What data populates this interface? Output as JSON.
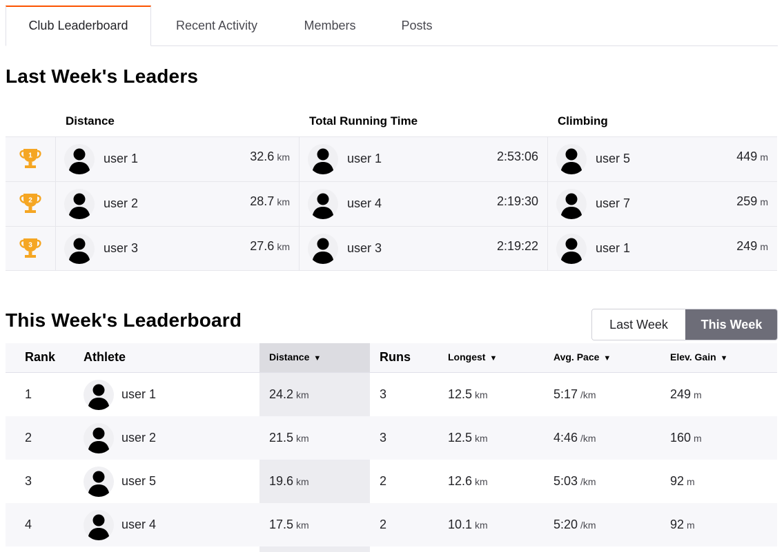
{
  "tabs": [
    {
      "label": "Club Leaderboard",
      "active": true
    },
    {
      "label": "Recent Activity",
      "active": false
    },
    {
      "label": "Members",
      "active": false
    },
    {
      "label": "Posts",
      "active": false
    }
  ],
  "colors": {
    "accent": "#fc5200",
    "trophy": "#f5a623",
    "toggle_active": "#6d6d78"
  },
  "leaders": {
    "title": "Last Week's Leaders",
    "headers": {
      "distance": "Distance",
      "time": "Total Running Time",
      "climbing": "Climbing"
    },
    "rows": [
      {
        "rank_icon": "trophy-1-icon",
        "rank": "1",
        "distance": {
          "user": "user 1",
          "value": "32.6",
          "unit": "km"
        },
        "time": {
          "user": "user 1",
          "value": "2:53:06"
        },
        "climbing": {
          "user": "user 5",
          "value": "449",
          "unit": "m"
        }
      },
      {
        "rank_icon": "trophy-2-icon",
        "rank": "2",
        "distance": {
          "user": "user 2",
          "value": "28.7",
          "unit": "km"
        },
        "time": {
          "user": "user 4",
          "value": "2:19:30"
        },
        "climbing": {
          "user": "user 7",
          "value": "259",
          "unit": "m"
        }
      },
      {
        "rank_icon": "trophy-3-icon",
        "rank": "3",
        "distance": {
          "user": "user 3",
          "value": "27.6",
          "unit": "km"
        },
        "time": {
          "user": "user 3",
          "value": "2:19:22"
        },
        "climbing": {
          "user": "user 1",
          "value": "249",
          "unit": "m"
        }
      }
    ]
  },
  "leaderboard": {
    "title": "This Week's Leaderboard",
    "toggle": {
      "last_week": "Last Week",
      "this_week": "This Week",
      "selected": "This Week"
    },
    "columns": {
      "rank": "Rank",
      "athlete": "Athlete",
      "distance": "Distance",
      "runs": "Runs",
      "longest": "Longest",
      "pace": "Avg. Pace",
      "elev": "Elev. Gain"
    },
    "sort_arrow": "▼",
    "rows": [
      {
        "rank": "1",
        "athlete": "user 1",
        "distance": "24.2",
        "distance_unit": "km",
        "runs": "3",
        "longest": "12.5",
        "longest_unit": "km",
        "pace": "5:17",
        "pace_unit": "/km",
        "elev": "249",
        "elev_unit": "m"
      },
      {
        "rank": "2",
        "athlete": "user 2",
        "distance": "21.5",
        "distance_unit": "km",
        "runs": "3",
        "longest": "12.5",
        "longest_unit": "km",
        "pace": "4:46",
        "pace_unit": "/km",
        "elev": "160",
        "elev_unit": "m"
      },
      {
        "rank": "3",
        "athlete": "user 5",
        "distance": "19.6",
        "distance_unit": "km",
        "runs": "2",
        "longest": "12.6",
        "longest_unit": "km",
        "pace": "5:03",
        "pace_unit": "/km",
        "elev": "92",
        "elev_unit": "m"
      },
      {
        "rank": "4",
        "athlete": "user 4",
        "distance": "17.5",
        "distance_unit": "km",
        "runs": "2",
        "longest": "10.1",
        "longest_unit": "km",
        "pace": "5:20",
        "pace_unit": "/km",
        "elev": "92",
        "elev_unit": "m"
      }
    ]
  }
}
